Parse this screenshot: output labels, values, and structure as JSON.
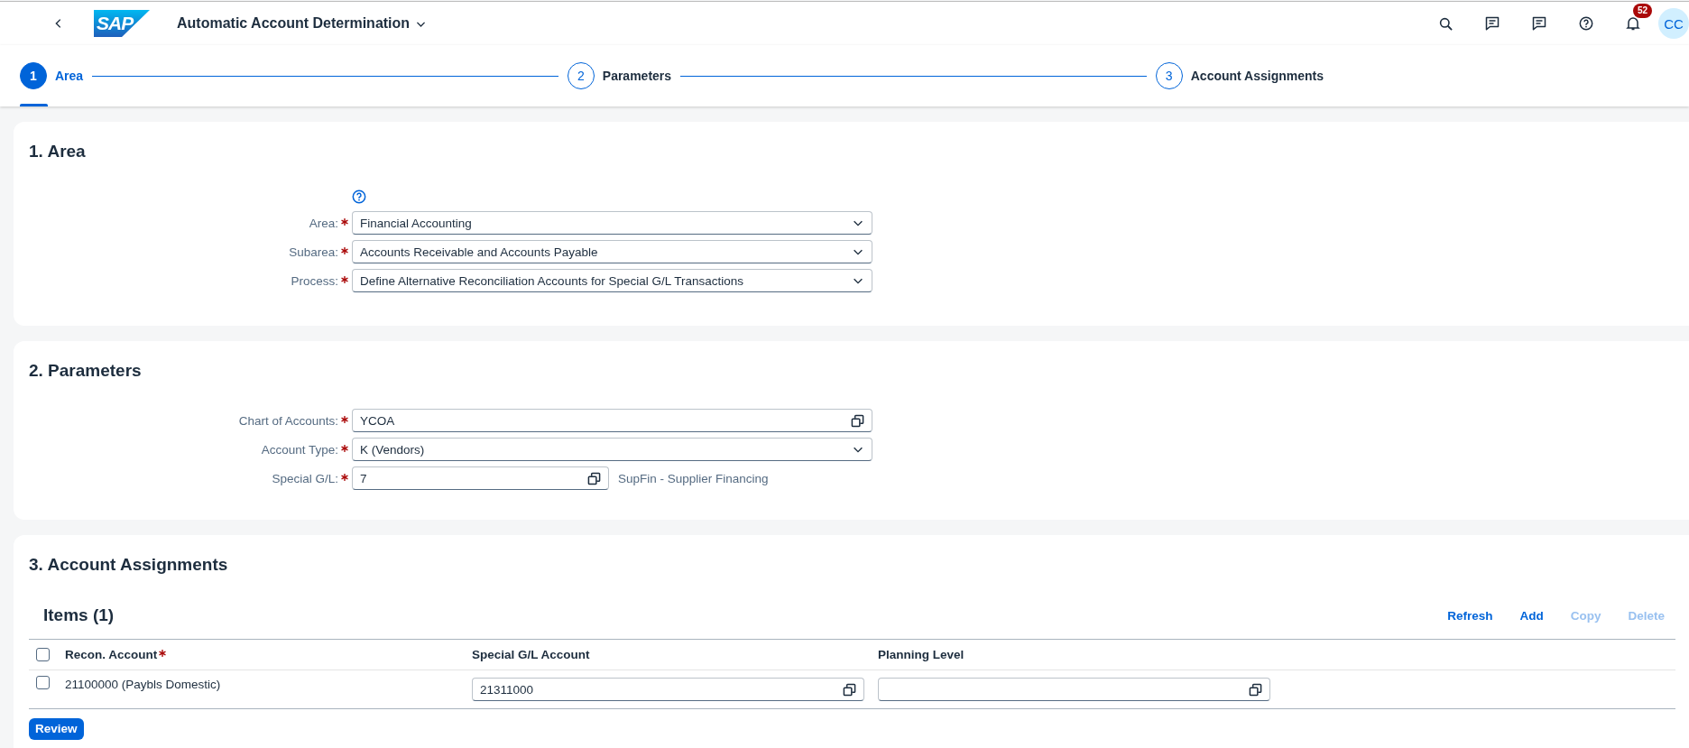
{
  "shell": {
    "logo": "SAP",
    "title": "Automatic Account Determination",
    "notification_count": "52",
    "avatar": "CC"
  },
  "wizard": [
    {
      "number": "1",
      "label": "Area",
      "selected": true
    },
    {
      "number": "2",
      "label": "Parameters",
      "selected": false
    },
    {
      "number": "3",
      "label": "Account Assignments",
      "selected": false
    }
  ],
  "area_section": {
    "title": "1. Area",
    "fields": [
      {
        "label": "Area:",
        "required": true,
        "kind": "select",
        "value": "Financial Accounting"
      },
      {
        "label": "Subarea:",
        "required": true,
        "kind": "select",
        "value": "Accounts Receivable and Accounts Payable"
      },
      {
        "label": "Process:",
        "required": true,
        "kind": "select",
        "value": "Define Alternative Reconciliation Accounts for Special G/L Transactions"
      }
    ]
  },
  "parameters_section": {
    "title": "2. Parameters",
    "fields": [
      {
        "label": "Chart of Accounts:",
        "required": true,
        "kind": "valuehelp",
        "value": "YCOA"
      },
      {
        "label": "Account Type:",
        "required": true,
        "kind": "select",
        "value": "K (Vendors)"
      },
      {
        "label": "Special G/L:",
        "required": true,
        "kind": "valuehelp",
        "value": "7",
        "description": "SupFin - Supplier Financing"
      }
    ]
  },
  "assignments_section": {
    "title": "3. Account Assignments",
    "table": {
      "title": "Items (1)",
      "actions": [
        {
          "label": "Refresh",
          "disabled": false
        },
        {
          "label": "Add",
          "disabled": false
        },
        {
          "label": "Copy",
          "disabled": true
        },
        {
          "label": "Delete",
          "disabled": true
        }
      ],
      "all_selected": false,
      "columns": [
        {
          "label": "Recon. Account",
          "required": true
        },
        {
          "label": "Special G/L Account",
          "required": false
        },
        {
          "label": "Planning Level",
          "required": false
        }
      ],
      "rows": [
        {
          "selected": false,
          "cells": [
            {
              "kind": "text",
              "value": "21100000 (Paybls Domestic)"
            },
            {
              "kind": "valuehelp",
              "value": "21311000"
            },
            {
              "kind": "valuehelp"
            }
          ]
        }
      ]
    },
    "button": "Review"
  }
}
